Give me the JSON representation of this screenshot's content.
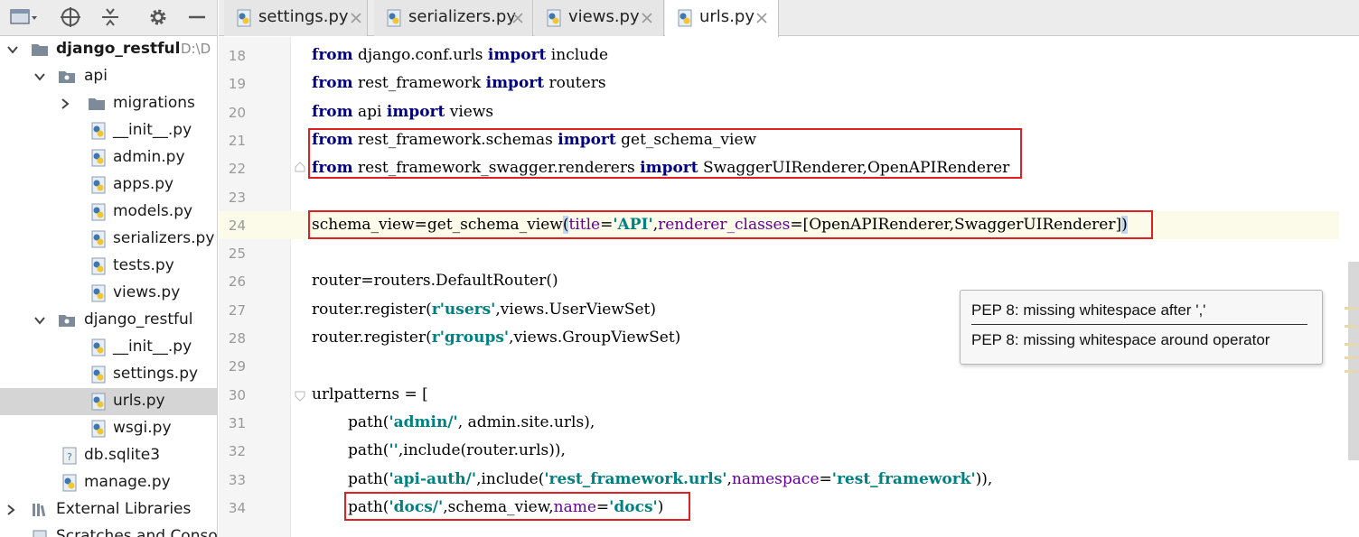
{
  "sidebar": {
    "tree": [
      {
        "label": "django_restful",
        "path": "D:\\D",
        "kind": "root-folder",
        "expanded": true,
        "bold": true
      },
      {
        "label": "api",
        "kind": "package",
        "expanded": true
      },
      {
        "label": "migrations",
        "kind": "folder",
        "expanded": false
      },
      {
        "label": "__init__.py",
        "kind": "python"
      },
      {
        "label": "admin.py",
        "kind": "python"
      },
      {
        "label": "apps.py",
        "kind": "python"
      },
      {
        "label": "models.py",
        "kind": "python"
      },
      {
        "label": "serializers.py",
        "kind": "python"
      },
      {
        "label": "tests.py",
        "kind": "python"
      },
      {
        "label": "views.py",
        "kind": "python"
      },
      {
        "label": "django_restful",
        "kind": "package",
        "expanded": true
      },
      {
        "label": "__init__.py",
        "kind": "python"
      },
      {
        "label": "settings.py",
        "kind": "python"
      },
      {
        "label": "urls.py",
        "kind": "python",
        "selected": true
      },
      {
        "label": "wsgi.py",
        "kind": "python"
      },
      {
        "label": "db.sqlite3",
        "kind": "db"
      },
      {
        "label": "manage.py",
        "kind": "python"
      },
      {
        "label": "External Libraries",
        "kind": "libraries",
        "expanded": false
      },
      {
        "label": "Scratches and Conso",
        "kind": "scratches"
      }
    ]
  },
  "tabs": [
    {
      "label": "settings.py",
      "active": false
    },
    {
      "label": "serializers.py",
      "active": false
    },
    {
      "label": "views.py",
      "active": false
    },
    {
      "label": "urls.py",
      "active": true
    }
  ],
  "editor": {
    "line_numbers": [
      "18",
      "19",
      "20",
      "21",
      "22",
      "23",
      "24",
      "25",
      "26",
      "27",
      "28",
      "29",
      "30",
      "31",
      "32",
      "33",
      "34"
    ],
    "lines": [
      [
        [
          "kw",
          "from"
        ],
        [
          "",
          " django.conf.urls "
        ],
        [
          "kw",
          "import"
        ],
        [
          "",
          " include"
        ]
      ],
      [
        [
          "kw",
          "from"
        ],
        [
          "",
          " rest_framework "
        ],
        [
          "kw",
          "import"
        ],
        [
          "",
          " routers"
        ]
      ],
      [
        [
          "kw",
          "from"
        ],
        [
          "",
          " api "
        ],
        [
          "kw",
          "import"
        ],
        [
          "",
          " views"
        ]
      ],
      [
        [
          "kw",
          "from"
        ],
        [
          "",
          " rest_framework.schemas "
        ],
        [
          "kw",
          "import"
        ],
        [
          "",
          " get_schema_view"
        ]
      ],
      [
        [
          "kw",
          "from"
        ],
        [
          "",
          " rest_framework_swagger.renderers "
        ],
        [
          "kw",
          "import"
        ],
        [
          "",
          " SwaggerUIRenderer,OpenAPIRenderer"
        ]
      ],
      [],
      [
        [
          "",
          "schema_view=get_schema_view"
        ],
        [
          "hl-paren",
          "("
        ],
        [
          "kwarg",
          "title"
        ],
        [
          "",
          "="
        ],
        [
          "str",
          "'API'"
        ],
        [
          "",
          ","
        ],
        [
          "kwarg",
          "renderer_classes"
        ],
        [
          "",
          "=[OpenAPIRenderer,SwaggerUIRenderer]"
        ],
        [
          "hl-paren",
          ")"
        ]
      ],
      [],
      [
        [
          "",
          "router=routers.DefaultRouter()"
        ]
      ],
      [
        [
          "",
          "router.register("
        ],
        [
          "str",
          "r'users'"
        ],
        [
          "",
          ",views.UserViewSet)"
        ]
      ],
      [
        [
          "",
          "router.register("
        ],
        [
          "str",
          "r'groups'"
        ],
        [
          "",
          ",views.GroupViewSet)"
        ]
      ],
      [],
      [
        [
          "",
          "urlpatterns = ["
        ]
      ],
      [
        [
          "",
          "path("
        ],
        [
          "str",
          "'admin/'"
        ],
        [
          "",
          ", admin.site.urls),"
        ]
      ],
      [
        [
          "",
          "path("
        ],
        [
          "str",
          "''"
        ],
        [
          "",
          ",include(router.urls)),"
        ]
      ],
      [
        [
          "",
          "path("
        ],
        [
          "str",
          "'api-auth/'"
        ],
        [
          "",
          ",include("
        ],
        [
          "str",
          "'rest_framework.urls'"
        ],
        [
          "",
          ","
        ],
        [
          "kwarg",
          "namespace"
        ],
        [
          "",
          "="
        ],
        [
          "str",
          "'rest_framework'"
        ],
        [
          "",
          ")),"
        ]
      ],
      [
        [
          "",
          "path("
        ],
        [
          "str",
          "'docs/'"
        ],
        [
          "",
          ",schema_view,"
        ],
        [
          "kwarg",
          "name"
        ],
        [
          "",
          "="
        ],
        [
          "str",
          "'docs'"
        ],
        [
          "",
          ")"
        ]
      ]
    ],
    "indented_lines": [
      13,
      14,
      15,
      16
    ],
    "current_line": "24"
  },
  "tooltip": {
    "messages": [
      "PEP 8: missing whitespace after ','",
      "PEP 8: missing whitespace around operator"
    ]
  },
  "colors": {
    "keyword": "#000080",
    "string": "#008080",
    "kwarg": "#660099",
    "annotation_box": "#e02020",
    "selected_row": "#d5d5d5"
  }
}
